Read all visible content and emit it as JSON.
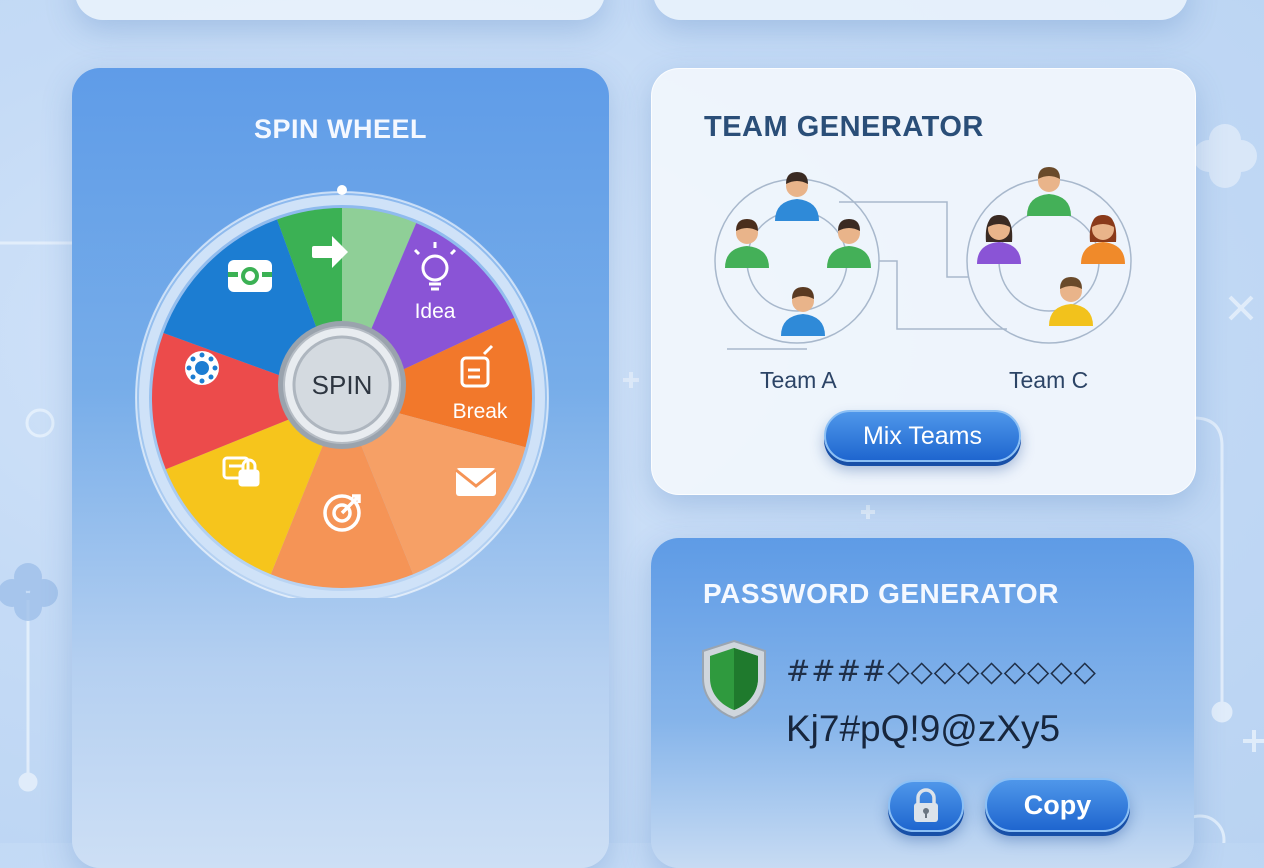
{
  "spin_wheel": {
    "title": "SPIN WHEEL",
    "center_label": "SPIN",
    "segments": [
      {
        "label": "",
        "color": "#8fcf97",
        "icon": "arrow-right-icon"
      },
      {
        "label": "",
        "color": "#8a54d6",
        "icon": "arrow-right-icon"
      },
      {
        "label": "Idea",
        "color": "#f2782b",
        "icon": "lightbulb-icon"
      },
      {
        "label": "Break",
        "color": "#f6a066",
        "icon": "coffee-cup-icon"
      },
      {
        "label": "",
        "color": "#f59456",
        "icon": "envelope-icon"
      },
      {
        "label": "",
        "color": "#f6c51c",
        "icon": "target-icon"
      },
      {
        "label": "",
        "color": "#ec4b4b",
        "icon": "lock-screen-icon"
      },
      {
        "label": "",
        "color": "#1c7dd2",
        "icon": "gear-dots-icon"
      },
      {
        "label": "",
        "color": "#3bb154",
        "icon": "camera-icon"
      }
    ]
  },
  "team_generator": {
    "title": "TEAM GENERATOR",
    "teams": [
      {
        "name": "Team A"
      },
      {
        "name": "Team C"
      }
    ],
    "mix_label": "Mix Teams"
  },
  "password_generator": {
    "title": "PASSWORD GENERATOR",
    "masked": "####◇◇◇◇◇◇◇◇◇",
    "password": "Kj7#pQ!9@zXy5",
    "copy_label": "Copy"
  }
}
